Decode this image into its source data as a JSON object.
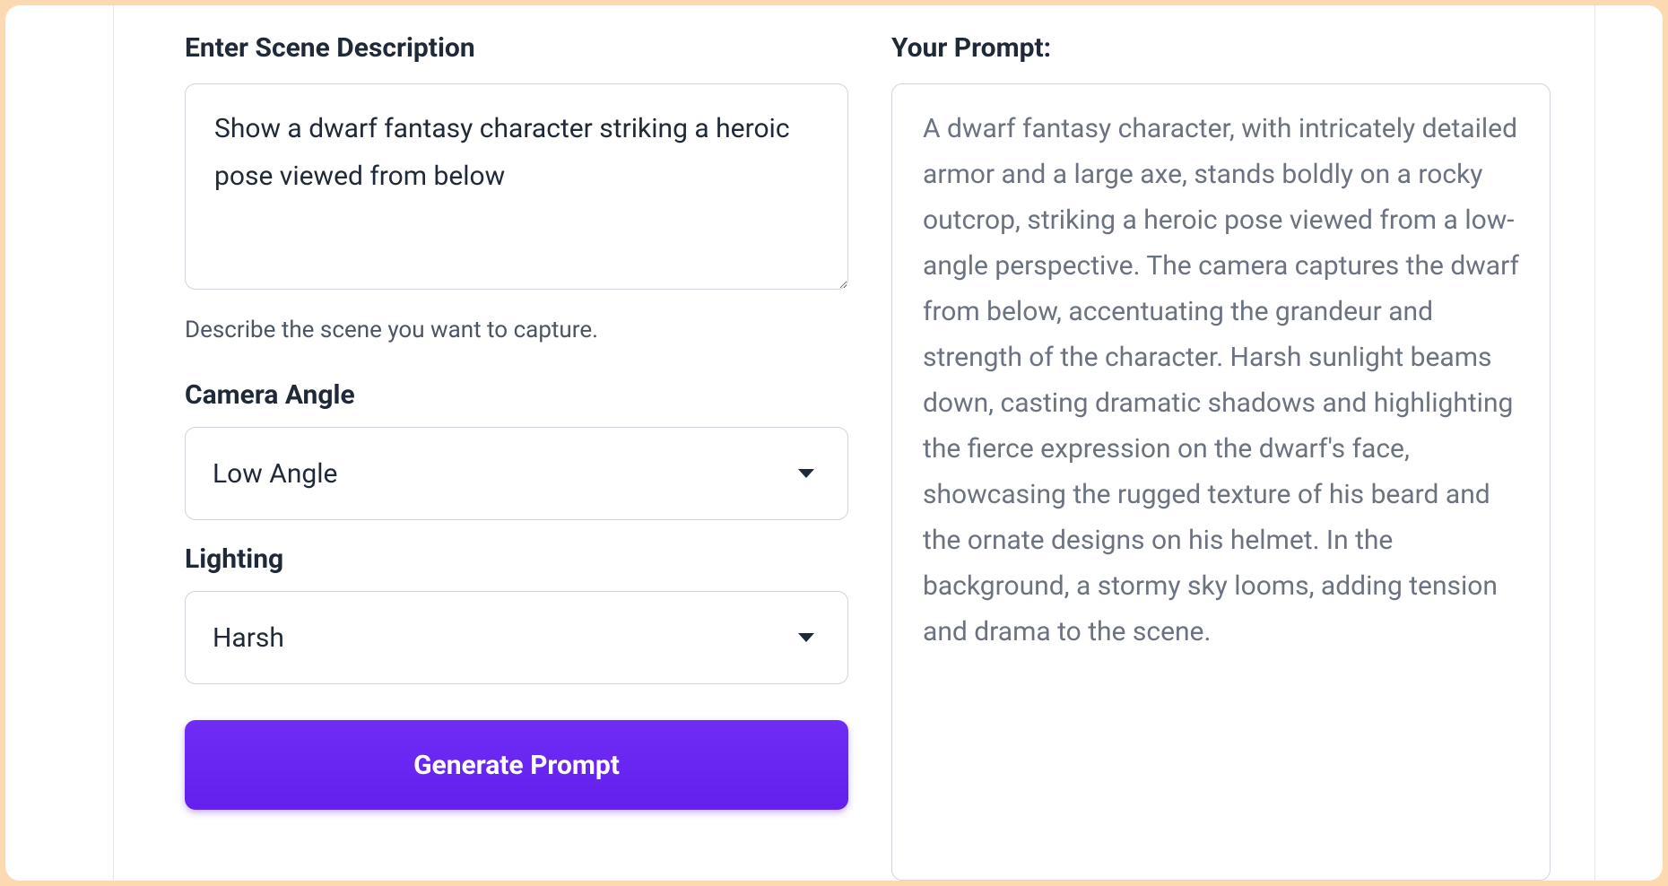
{
  "left": {
    "scene_label": "Enter Scene Description",
    "scene_value": "Show a dwarf fantasy character striking a heroic pose viewed from below",
    "scene_helper": "Describe the scene you want to capture.",
    "angle_label": "Camera Angle",
    "angle_value": "Low Angle",
    "lighting_label": "Lighting",
    "lighting_value": "Harsh",
    "generate_label": "Generate Prompt"
  },
  "right": {
    "title": "Your Prompt:",
    "output": "A dwarf fantasy character, with intricately detailed armor and a large axe, stands boldly on a rocky outcrop, striking a heroic pose viewed from a low-angle perspective. The camera captures the dwarf from below, accentuating the grandeur and strength of the character. Harsh sunlight beams down, casting dramatic shadows and highlighting the fierce expression on the dwarf's face, showcasing the rugged texture of his beard and the ornate designs on his helmet. In the background, a stormy sky looms, adding tension and drama to the scene."
  }
}
